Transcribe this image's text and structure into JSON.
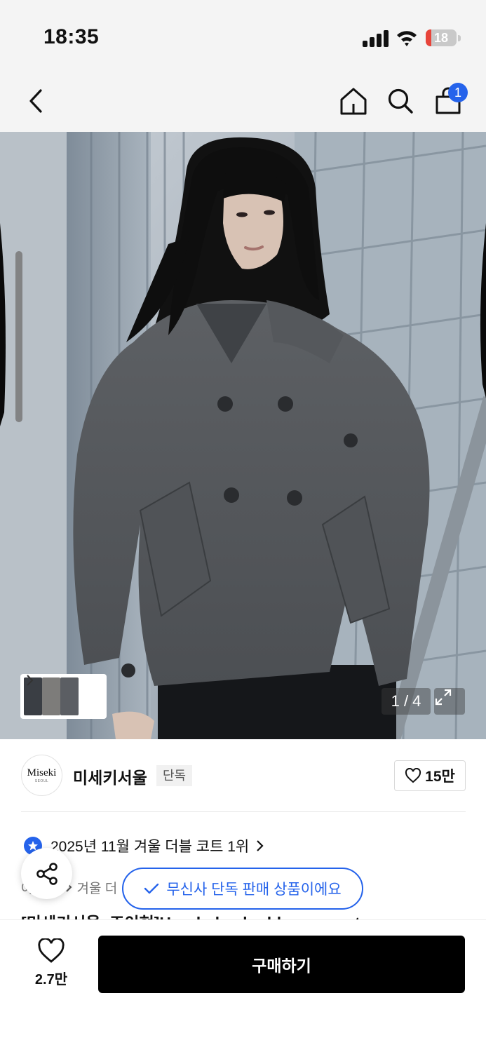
{
  "status_bar": {
    "time": "18:35",
    "battery": "18",
    "battery_level": 0.18,
    "signal_bars": 4
  },
  "nav": {
    "icons": [
      "back-arrow-icon",
      "home-icon",
      "search-icon",
      "cart-icon"
    ],
    "cart_badge": "1"
  },
  "gallery": {
    "page_counter": "1 / 4",
    "current_page": 1,
    "total_pages": 4
  },
  "brand": {
    "logo_text": "Miseki",
    "logo_subtext": "SEOUL",
    "name": "미세키서울",
    "tag": "단독",
    "like_count": "15만"
  },
  "ranking": {
    "text": "2025년 11월 겨울 더블 코트 1위"
  },
  "category": {
    "first": "아",
    "second": "겨울 더"
  },
  "exclusive_badge": {
    "text": "무신사 단독 판매 상품이에요"
  },
  "product": {
    "title_partial": "[미세키서울x조이현]Hooded ...double pea coat"
  },
  "bottom_bar": {
    "wish_count": "2.7만",
    "buy_label": "구매하기"
  },
  "colors": {
    "accent": "#2563eb",
    "buy_button": "#000000",
    "battery_low": "#e8443a"
  }
}
